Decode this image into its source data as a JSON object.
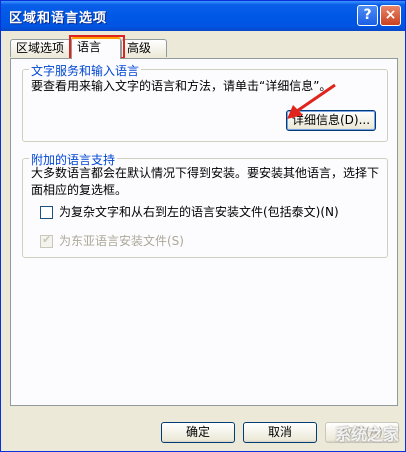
{
  "window": {
    "title": "区域和语言选项",
    "help_glyph": "?",
    "close_glyph": "×"
  },
  "tabs": [
    {
      "label": "区域选项"
    },
    {
      "label": "语言"
    },
    {
      "label": "高级"
    }
  ],
  "text_services": {
    "group_title": "文字服务和输入语言",
    "description": "要查看用来输入文字的语言和方法，请单击“详细信息”。",
    "details_button": "详细信息(D)..."
  },
  "supplemental": {
    "group_title": "附加的语言支持",
    "description": "大多数语言都会在默认情况下得到安装。要安装其他语言，选择下面相应的复选框。",
    "complex_script_label": "为复杂文字和从右到左的语言安装文件(包括泰文)(N)",
    "complex_script_checked": false,
    "east_asian_label": "为东亚语言安装文件(S)",
    "east_asian_checked": true
  },
  "footer": {
    "ok": "确定",
    "cancel": "取消",
    "apply": "应用(A)"
  },
  "colors": {
    "highlight": "#e0231c",
    "group_title": "#0046d5"
  },
  "watermark": "系统之家"
}
